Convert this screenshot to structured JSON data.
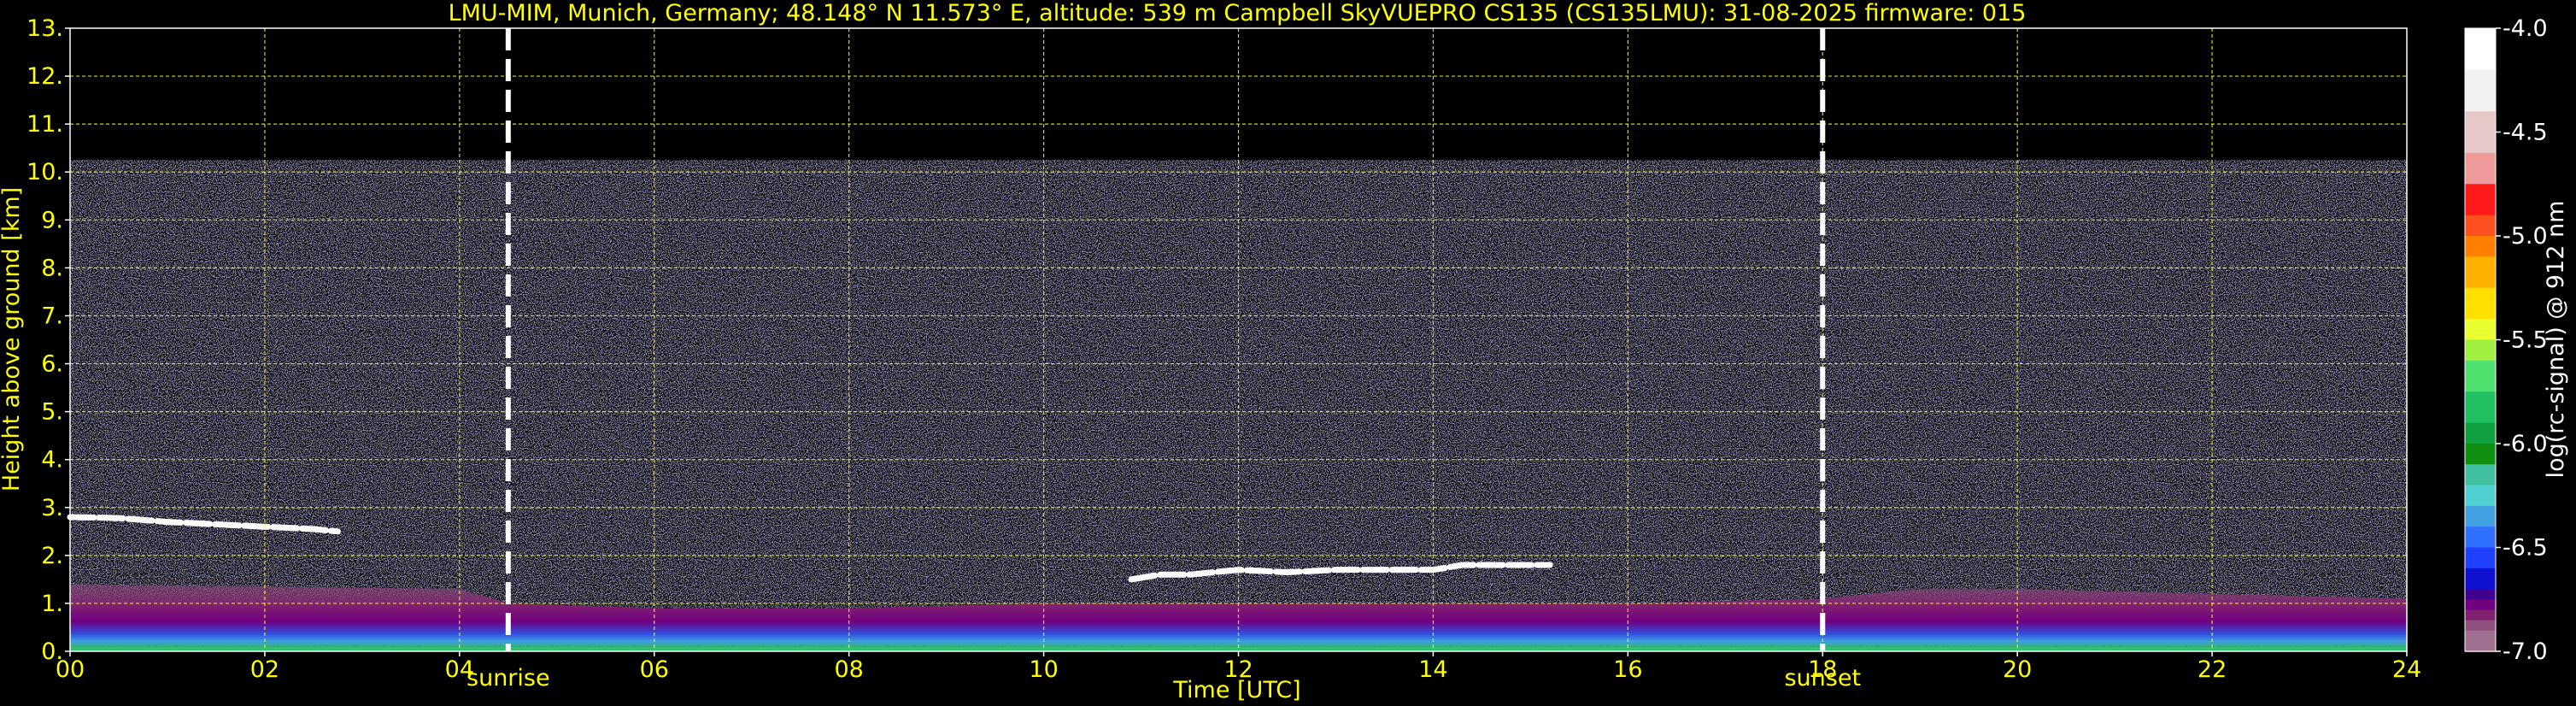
{
  "chart_data": {
    "type": "heatmap",
    "title": "LMU-MIM, Munich, Germany; 48.148° N 11.573° E, altitude: 539 m    Campbell SkyVUEPRO CS135 (CS135LMU): 31-08-2025    firmware: 015",
    "xlabel": "Time [UTC]",
    "ylabel": "Height above ground [km]",
    "xlim": [
      0,
      24
    ],
    "ylim": [
      0,
      13
    ],
    "xticks": [
      "00",
      "02",
      "04",
      "06",
      "08",
      "10",
      "12",
      "14",
      "16",
      "18",
      "20",
      "22",
      "24"
    ],
    "yticks": [
      "0.",
      "1.",
      "2.",
      "3.",
      "4.",
      "5.",
      "6.",
      "7.",
      "8.",
      "9.",
      "10.",
      "11.",
      "12.",
      "13."
    ],
    "grid": true,
    "sunrise": {
      "label": "sunrise",
      "x": 4.5
    },
    "sunset": {
      "label": "sunset",
      "x": 18.0
    },
    "signal_top_km": 10.25,
    "colorbar": {
      "label": "log(rc-signal) @ 912 nm",
      "range": [
        -7.0,
        -4.0
      ],
      "ticks": [
        "-4.0",
        "-4.5",
        "-5.0",
        "-5.5",
        "-6.0",
        "-6.5",
        "-7.0"
      ],
      "colors": [
        "#ffffff",
        "#f2f2f2",
        "#e6c8c8",
        "#ee9a9a",
        "#ff1a1a",
        "#ff5020",
        "#ff8000",
        "#ffb000",
        "#ffe000",
        "#e8ff30",
        "#a0f040",
        "#50e070",
        "#20c060",
        "#10a040",
        "#109010",
        "#40c0a0",
        "#50d0d0",
        "#40a0e0",
        "#3070ff",
        "#2040ff",
        "#1010d0",
        "#400090",
        "#700080",
        "#802070",
        "#905080",
        "#a07090",
        "#b0909c"
      ],
      "color_values": [
        -4.0,
        -4.2,
        -4.4,
        -4.6,
        -4.75,
        -4.9,
        -5.0,
        -5.1,
        -5.25,
        -5.4,
        -5.5,
        -5.6,
        -5.75,
        -5.9,
        -6.0,
        -6.1,
        -6.2,
        -6.3,
        -6.4,
        -6.5,
        -6.6,
        -6.7,
        -6.75,
        -6.8,
        -6.85,
        -6.9,
        -7.0
      ]
    },
    "features": {
      "cloud_layer_early": {
        "t": [
          0,
          0.5,
          1.0,
          1.5,
          2.0,
          2.5,
          2.75
        ],
        "h": [
          2.8,
          2.78,
          2.7,
          2.65,
          2.6,
          2.55,
          2.5
        ]
      },
      "cloud_layer_midday": {
        "t": [
          10.9,
          11.2,
          11.5,
          12.0,
          12.5,
          13.0,
          13.5,
          14.0,
          14.3,
          15.2
        ],
        "h": [
          1.5,
          1.6,
          1.6,
          1.7,
          1.65,
          1.7,
          1.7,
          1.7,
          1.8,
          1.8
        ]
      },
      "boundary_layer_top": {
        "t": [
          0,
          2,
          4,
          4.5,
          6,
          8,
          10,
          12,
          14,
          16,
          18,
          19,
          20,
          22,
          24
        ],
        "h": [
          1.4,
          1.35,
          1.3,
          1.0,
          0.9,
          0.9,
          1.0,
          1.0,
          1.0,
          1.0,
          1.1,
          1.3,
          1.3,
          1.2,
          1.1
        ]
      }
    }
  }
}
